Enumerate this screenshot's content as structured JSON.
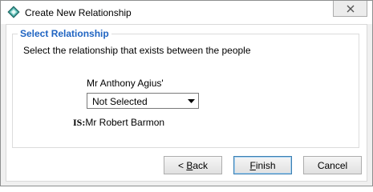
{
  "window": {
    "title": "Create New Relationship",
    "close_icon": "close-icon"
  },
  "group": {
    "title": "Select Relationship",
    "instruction": "Select the relationship that exists between the people",
    "instruction_overflow": "below"
  },
  "relationship": {
    "person_a": "Mr Anthony Agius'",
    "select_value": "Not Selected",
    "is_label": "IS:",
    "person_b": "Mr Robert Barmon"
  },
  "buttons": {
    "back_prefix": "< ",
    "back_mnemonic": "B",
    "back_rest": "ack",
    "finish_mnemonic": "F",
    "finish_rest": "inish",
    "cancel": "Cancel"
  }
}
